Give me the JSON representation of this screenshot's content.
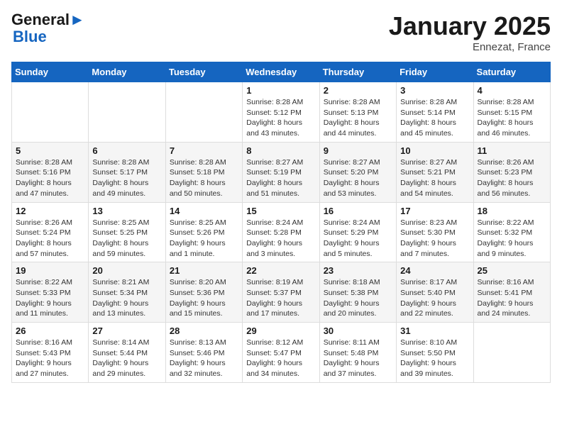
{
  "logo": {
    "general": "General",
    "blue": "Blue"
  },
  "header": {
    "title": "January 2025",
    "location": "Ennezat, France"
  },
  "weekdays": [
    "Sunday",
    "Monday",
    "Tuesday",
    "Wednesday",
    "Thursday",
    "Friday",
    "Saturday"
  ],
  "weeks": [
    [
      {
        "day": "",
        "info": ""
      },
      {
        "day": "",
        "info": ""
      },
      {
        "day": "",
        "info": ""
      },
      {
        "day": "1",
        "info": "Sunrise: 8:28 AM\nSunset: 5:12 PM\nDaylight: 8 hours\nand 43 minutes."
      },
      {
        "day": "2",
        "info": "Sunrise: 8:28 AM\nSunset: 5:13 PM\nDaylight: 8 hours\nand 44 minutes."
      },
      {
        "day": "3",
        "info": "Sunrise: 8:28 AM\nSunset: 5:14 PM\nDaylight: 8 hours\nand 45 minutes."
      },
      {
        "day": "4",
        "info": "Sunrise: 8:28 AM\nSunset: 5:15 PM\nDaylight: 8 hours\nand 46 minutes."
      }
    ],
    [
      {
        "day": "5",
        "info": "Sunrise: 8:28 AM\nSunset: 5:16 PM\nDaylight: 8 hours\nand 47 minutes."
      },
      {
        "day": "6",
        "info": "Sunrise: 8:28 AM\nSunset: 5:17 PM\nDaylight: 8 hours\nand 49 minutes."
      },
      {
        "day": "7",
        "info": "Sunrise: 8:28 AM\nSunset: 5:18 PM\nDaylight: 8 hours\nand 50 minutes."
      },
      {
        "day": "8",
        "info": "Sunrise: 8:27 AM\nSunset: 5:19 PM\nDaylight: 8 hours\nand 51 minutes."
      },
      {
        "day": "9",
        "info": "Sunrise: 8:27 AM\nSunset: 5:20 PM\nDaylight: 8 hours\nand 53 minutes."
      },
      {
        "day": "10",
        "info": "Sunrise: 8:27 AM\nSunset: 5:21 PM\nDaylight: 8 hours\nand 54 minutes."
      },
      {
        "day": "11",
        "info": "Sunrise: 8:26 AM\nSunset: 5:23 PM\nDaylight: 8 hours\nand 56 minutes."
      }
    ],
    [
      {
        "day": "12",
        "info": "Sunrise: 8:26 AM\nSunset: 5:24 PM\nDaylight: 8 hours\nand 57 minutes."
      },
      {
        "day": "13",
        "info": "Sunrise: 8:25 AM\nSunset: 5:25 PM\nDaylight: 8 hours\nand 59 minutes."
      },
      {
        "day": "14",
        "info": "Sunrise: 8:25 AM\nSunset: 5:26 PM\nDaylight: 9 hours\nand 1 minute."
      },
      {
        "day": "15",
        "info": "Sunrise: 8:24 AM\nSunset: 5:28 PM\nDaylight: 9 hours\nand 3 minutes."
      },
      {
        "day": "16",
        "info": "Sunrise: 8:24 AM\nSunset: 5:29 PM\nDaylight: 9 hours\nand 5 minutes."
      },
      {
        "day": "17",
        "info": "Sunrise: 8:23 AM\nSunset: 5:30 PM\nDaylight: 9 hours\nand 7 minutes."
      },
      {
        "day": "18",
        "info": "Sunrise: 8:22 AM\nSunset: 5:32 PM\nDaylight: 9 hours\nand 9 minutes."
      }
    ],
    [
      {
        "day": "19",
        "info": "Sunrise: 8:22 AM\nSunset: 5:33 PM\nDaylight: 9 hours\nand 11 minutes."
      },
      {
        "day": "20",
        "info": "Sunrise: 8:21 AM\nSunset: 5:34 PM\nDaylight: 9 hours\nand 13 minutes."
      },
      {
        "day": "21",
        "info": "Sunrise: 8:20 AM\nSunset: 5:36 PM\nDaylight: 9 hours\nand 15 minutes."
      },
      {
        "day": "22",
        "info": "Sunrise: 8:19 AM\nSunset: 5:37 PM\nDaylight: 9 hours\nand 17 minutes."
      },
      {
        "day": "23",
        "info": "Sunrise: 8:18 AM\nSunset: 5:38 PM\nDaylight: 9 hours\nand 20 minutes."
      },
      {
        "day": "24",
        "info": "Sunrise: 8:17 AM\nSunset: 5:40 PM\nDaylight: 9 hours\nand 22 minutes."
      },
      {
        "day": "25",
        "info": "Sunrise: 8:16 AM\nSunset: 5:41 PM\nDaylight: 9 hours\nand 24 minutes."
      }
    ],
    [
      {
        "day": "26",
        "info": "Sunrise: 8:16 AM\nSunset: 5:43 PM\nDaylight: 9 hours\nand 27 minutes."
      },
      {
        "day": "27",
        "info": "Sunrise: 8:14 AM\nSunset: 5:44 PM\nDaylight: 9 hours\nand 29 minutes."
      },
      {
        "day": "28",
        "info": "Sunrise: 8:13 AM\nSunset: 5:46 PM\nDaylight: 9 hours\nand 32 minutes."
      },
      {
        "day": "29",
        "info": "Sunrise: 8:12 AM\nSunset: 5:47 PM\nDaylight: 9 hours\nand 34 minutes."
      },
      {
        "day": "30",
        "info": "Sunrise: 8:11 AM\nSunset: 5:48 PM\nDaylight: 9 hours\nand 37 minutes."
      },
      {
        "day": "31",
        "info": "Sunrise: 8:10 AM\nSunset: 5:50 PM\nDaylight: 9 hours\nand 39 minutes."
      },
      {
        "day": "",
        "info": ""
      }
    ]
  ]
}
